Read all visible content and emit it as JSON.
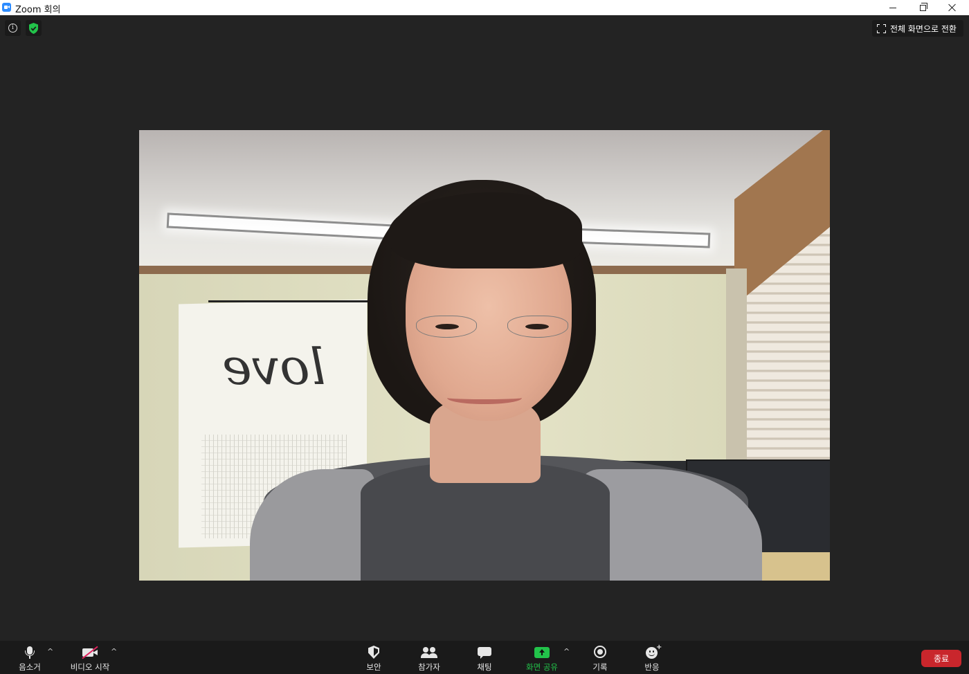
{
  "window": {
    "title": "Zoom 회의",
    "controls": [
      "minimize-icon",
      "restore-icon",
      "close-icon"
    ]
  },
  "overlay": {
    "info_icon": "info-icon",
    "security_icon": "shield-check-icon",
    "security_color": "#22c34a",
    "fullscreen_label": "전체 화면으로 전환"
  },
  "video": {
    "poster_text": "love"
  },
  "toolbar": {
    "mute_label": "음소거",
    "video_label": "비디오 시작",
    "security_label": "보안",
    "participants_label": "참가자",
    "chat_label": "채팅",
    "share_label": "화면 공유",
    "record_label": "기록",
    "reactions_label": "반응",
    "end_label": "종료",
    "share_color": "#22c34a",
    "end_color": "#c9262c"
  }
}
